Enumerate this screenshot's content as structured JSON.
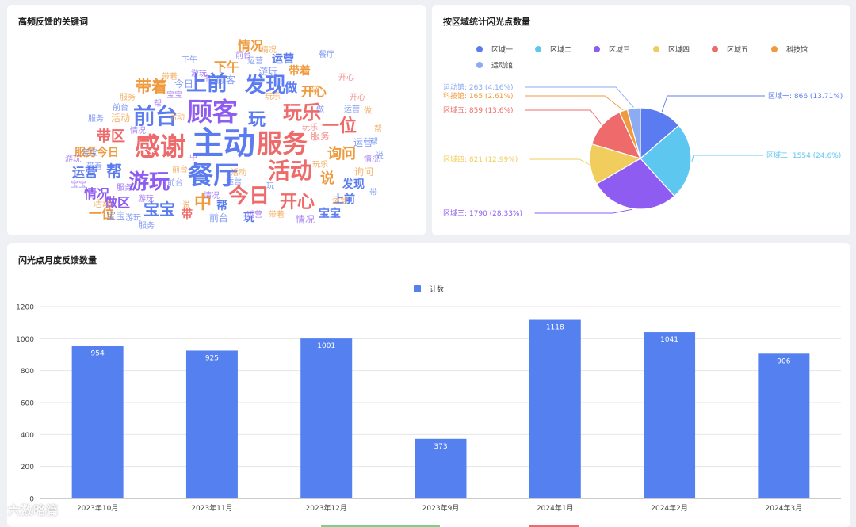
{
  "wordcloud": {
    "title": "高频反馈的关键词",
    "words": [
      {
        "text": "主动",
        "color": "#5b7cf0"
      },
      {
        "text": "服务",
        "color": "#ef6b6b"
      },
      {
        "text": "感谢",
        "color": "#ef6b6b"
      },
      {
        "text": "餐厅",
        "color": "#5b7cf0"
      },
      {
        "text": "顾客",
        "color": "#8e5cf0"
      },
      {
        "text": "前台",
        "color": "#5b7cf0"
      },
      {
        "text": "上前",
        "color": "#5b7cf0"
      },
      {
        "text": "发现",
        "color": "#5b7cf0"
      },
      {
        "text": "活动",
        "color": "#ef6b6b"
      },
      {
        "text": "游玩",
        "color": "#8e5cf0"
      },
      {
        "text": "今日",
        "color": "#ef6b6b"
      },
      {
        "text": "开心",
        "color": "#ef6b6b"
      },
      {
        "text": "中",
        "color": "#ef9a3c"
      },
      {
        "text": "玩乐",
        "color": "#ef6b6b"
      },
      {
        "text": "一位",
        "color": "#ef6b6b"
      },
      {
        "text": "询问",
        "color": "#ef9a3c"
      },
      {
        "text": "玩",
        "color": "#5b7cf0"
      },
      {
        "text": "带着",
        "color": "#ef9a3c"
      },
      {
        "text": "带区",
        "color": "#ef6b6b"
      },
      {
        "text": "宝宝",
        "color": "#5b7cf0"
      },
      {
        "text": "帮",
        "color": "#5b7cf0"
      },
      {
        "text": "运营",
        "color": "#5b7cf0"
      },
      {
        "text": "情况",
        "color": "#8e5cf0"
      },
      {
        "text": "服务今日",
        "color": "#ef9a3c"
      },
      {
        "text": "下午",
        "color": "#ef9a3c"
      },
      {
        "text": "做",
        "color": "#5b7cf0"
      },
      {
        "text": "说",
        "color": "#ef9a3c"
      },
      {
        "text": "一位",
        "color": "#ef9a3c"
      },
      {
        "text": "做区",
        "color": "#8e5cf0"
      },
      {
        "text": "带",
        "color": "#ef6b6b"
      },
      {
        "text": "前台",
        "color": "#5b7cf0"
      },
      {
        "text": "玩",
        "color": "#5b7cf0"
      },
      {
        "text": "帮",
        "color": "#5b7cf0"
      },
      {
        "text": "情况",
        "color": "#ef9a3c"
      },
      {
        "text": "运营",
        "color": "#5b7cf0"
      },
      {
        "text": "带着",
        "color": "#ef9a3c"
      },
      {
        "text": "做",
        "color": "#ef9a3c"
      },
      {
        "text": "发现",
        "color": "#5b7cf0"
      },
      {
        "text": "宝宝",
        "color": "#5b7cf0"
      },
      {
        "text": "开心",
        "color": "#ef9a3c"
      },
      {
        "text": "游玩",
        "color": "#5b7cf0"
      },
      {
        "text": "上前",
        "color": "#5b7cf0"
      },
      {
        "text": "情况",
        "color": "#8e5cf0"
      },
      {
        "text": "活动",
        "color": "#ef9a3c"
      },
      {
        "text": "帮",
        "color": "#8e5cf0"
      },
      {
        "text": "服务",
        "color": "#ef6b6b"
      },
      {
        "text": "运营",
        "color": "#5b7cf0"
      },
      {
        "text": "询问",
        "color": "#ef9a3c"
      },
      {
        "text": "情况",
        "color": "#8e5cf0"
      },
      {
        "text": "宝宝",
        "color": "#5b7cf0"
      },
      {
        "text": "今日",
        "color": "#5b7cf0"
      },
      {
        "text": "前台",
        "color": "#5b7cf0"
      },
      {
        "text": "活动",
        "color": "#ef9a3c"
      },
      {
        "text": "带着",
        "color": "#ef9a3c"
      },
      {
        "text": "情况",
        "color": "#ef9a3c"
      },
      {
        "text": "宝宝",
        "color": "#8e5cf0"
      },
      {
        "text": "前台",
        "color": "#ef9a3c"
      },
      {
        "text": "游玩",
        "color": "#8e5cf0"
      },
      {
        "text": "服务",
        "color": "#ef9a3c"
      },
      {
        "text": "顾客",
        "color": "#5b7cf0"
      },
      {
        "text": "运营",
        "color": "#5b7cf0"
      },
      {
        "text": "玩乐",
        "color": "#ef6b6b"
      },
      {
        "text": "中",
        "color": "#8e5cf0"
      },
      {
        "text": "做",
        "color": "#ef9a3c"
      },
      {
        "text": "说",
        "color": "#5b7cf0"
      },
      {
        "text": "开心",
        "color": "#ef6b6b"
      },
      {
        "text": "帮",
        "color": "#5b7cf0"
      },
      {
        "text": "下午",
        "color": "#5b7cf0"
      },
      {
        "text": "游玩",
        "color": "#8e5cf0"
      },
      {
        "text": "带着",
        "color": "#5b7cf0"
      },
      {
        "text": "情况",
        "color": "#8e5cf0"
      },
      {
        "text": "餐厅",
        "color": "#5b7cf0"
      },
      {
        "text": "服务",
        "color": "#5b7cf0"
      },
      {
        "text": "运营",
        "color": "#8e5cf0"
      },
      {
        "text": "宝宝",
        "color": "#5b7cf0"
      },
      {
        "text": "玩乐",
        "color": "#ef9a3c"
      },
      {
        "text": "游玩",
        "color": "#5b7cf0"
      },
      {
        "text": "前台",
        "color": "#8e5cf0"
      },
      {
        "text": "运营",
        "color": "#5b7cf0"
      },
      {
        "text": "做",
        "color": "#5b7cf0"
      },
      {
        "text": "宝宝",
        "color": "#8e5cf0"
      },
      {
        "text": "帮",
        "color": "#ef9a3c"
      },
      {
        "text": "开心",
        "color": "#ef6b6b"
      },
      {
        "text": "服务",
        "color": "#5b7cf0"
      },
      {
        "text": "玩",
        "color": "#5b7cf0"
      },
      {
        "text": "活动",
        "color": "#ef9a3c"
      },
      {
        "text": "游玩",
        "color": "#8e5cf0"
      },
      {
        "text": "带着",
        "color": "#ef9a3c"
      },
      {
        "text": "前台",
        "color": "#5b7cf0"
      },
      {
        "text": "运营",
        "color": "#ef9a3c"
      },
      {
        "text": "服务",
        "color": "#8e5cf0"
      },
      {
        "text": "中",
        "color": "#8e5cf0"
      },
      {
        "text": "玩乐",
        "color": "#ef9a3c"
      },
      {
        "text": "带",
        "color": "#5b7cf0"
      },
      {
        "text": "说",
        "color": "#ef9a3c"
      },
      {
        "text": "情况",
        "color": "#8e5cf0"
      },
      {
        "text": "运营",
        "color": "#5b7cf0"
      },
      {
        "text": "活动",
        "color": "#ef9a3c"
      }
    ]
  },
  "pie": {
    "title": "按区域统计闪光点数量",
    "chart_data": {
      "type": "pie",
      "slices": [
        {
          "name": "区域一",
          "value": 866,
          "label": "区域一: 866 (13.71%)",
          "color": "#5b7cf0"
        },
        {
          "name": "区域二",
          "value": 1554,
          "label": "区域二: 1554 (24.6%)",
          "color": "#5ec7f0"
        },
        {
          "name": "区域三",
          "value": 1790,
          "label": "区域三: 1790 (28.33%)",
          "color": "#8e5cf0"
        },
        {
          "name": "区域四",
          "value": 821,
          "label": "区域四: 821 (12.99%)",
          "color": "#f0cd5c"
        },
        {
          "name": "区域五",
          "value": 859,
          "label": "区域五: 859 (13.6%)",
          "color": "#ef6b6b"
        },
        {
          "name": "科技馆",
          "value": 165,
          "label": "科技馆: 165 (2.61%)",
          "color": "#ef9a3c"
        },
        {
          "name": "运动馆",
          "value": 263,
          "label": "运动馆: 263 (4.16%)",
          "color": "#8cabf0"
        }
      ],
      "legend_position": "top"
    }
  },
  "bar": {
    "title": "闪光点月度反馈数量",
    "chart_data": {
      "type": "bar",
      "categories": [
        "2023年10月",
        "2023年11月",
        "2023年12月",
        "2023年9月",
        "2024年1月",
        "2024年2月",
        "2024年3月"
      ],
      "series": [
        {
          "name": "计数",
          "values": [
            954,
            925,
            1001,
            373,
            1118,
            1041,
            906
          ],
          "color": "#5480f0"
        }
      ],
      "ylim": [
        0,
        1200
      ],
      "yticks": [
        0,
        200,
        400,
        600,
        800,
        1000,
        1200
      ],
      "grid": true,
      "legend_position": "top"
    }
  },
  "watermark": "六数略篇"
}
